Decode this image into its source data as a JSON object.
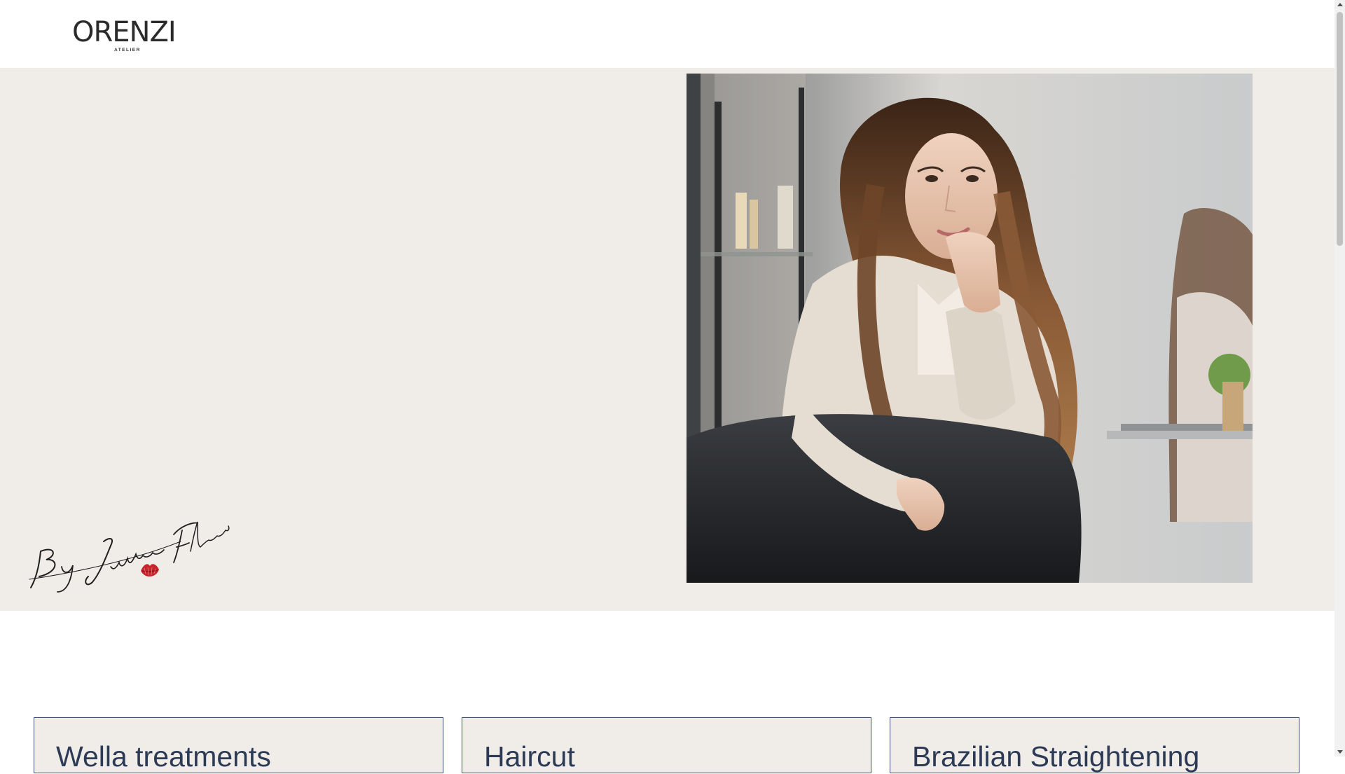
{
  "header": {
    "logo_text": "ORENZI",
    "logo_subtext": "ATELIER"
  },
  "hero": {
    "signature_text": "By Juliane Florencio",
    "photo_description": "hero-portrait-photo"
  },
  "services": [
    {
      "title": "Wella treatments"
    },
    {
      "title": "Haircut"
    },
    {
      "title": "Brazilian Straightening"
    }
  ],
  "colors": {
    "hero_bg": "#f0ede9",
    "card_border": "#3a4a6b",
    "card_text": "#2d3a55",
    "lips_red": "#c8242d"
  },
  "icons": {
    "scroll_up": "arrow-up-icon",
    "scroll_down": "arrow-down-icon",
    "lips": "lips-icon"
  }
}
